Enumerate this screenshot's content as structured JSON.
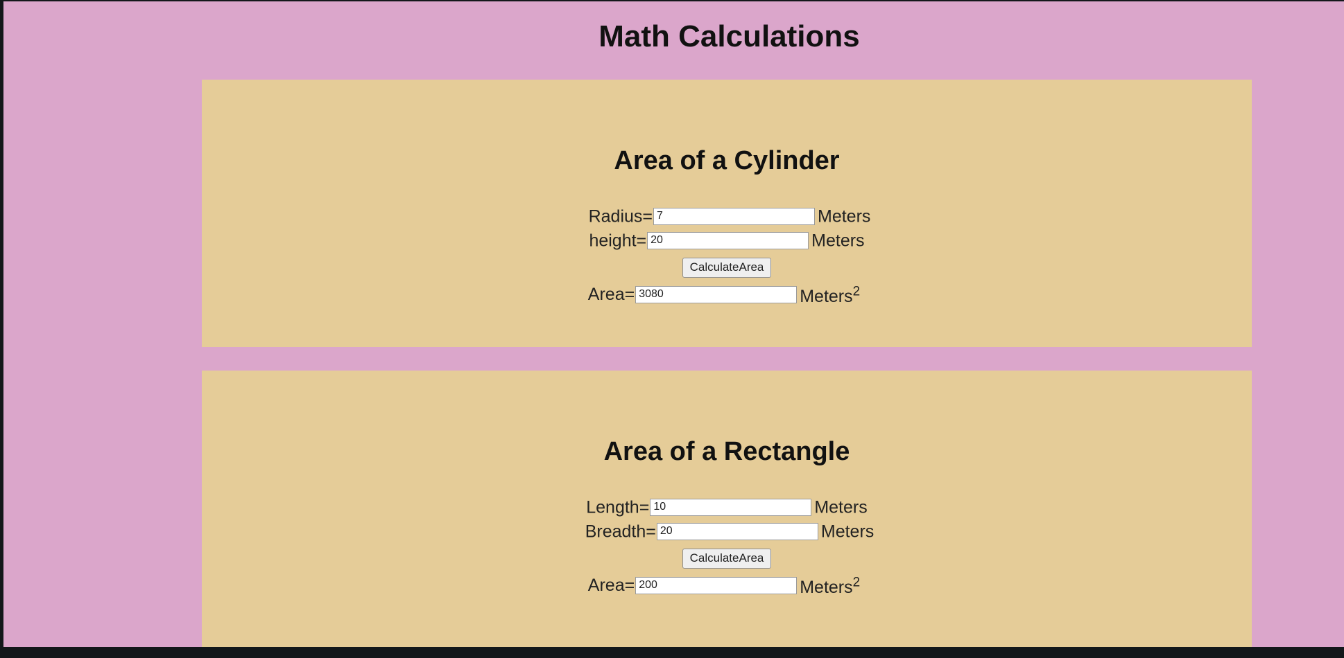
{
  "page": {
    "title": "Math Calculations"
  },
  "cylinder": {
    "heading": "Area of a Cylinder",
    "radius_label": "Radius=",
    "radius_value": "7",
    "radius_unit": "Meters",
    "height_label": "height=",
    "height_value": "20",
    "height_unit": "Meters",
    "button_label": "CalculateArea",
    "area_label": "Area=",
    "area_value": "3080",
    "area_unit": "Meters",
    "area_exponent": "2"
  },
  "rectangle": {
    "heading": "Area of a Rectangle",
    "length_label": "Length=",
    "length_value": "10",
    "length_unit": "Meters",
    "breadth_label": "Breadth=",
    "breadth_value": "20",
    "breadth_unit": "Meters",
    "button_label": "CalculateArea",
    "area_label": "Area=",
    "area_value": "200",
    "area_unit": "Meters",
    "area_exponent": "2"
  },
  "colors": {
    "page_background": "#dba6cb",
    "panel_background": "#e5cc98",
    "taskbar": "#13171a"
  }
}
